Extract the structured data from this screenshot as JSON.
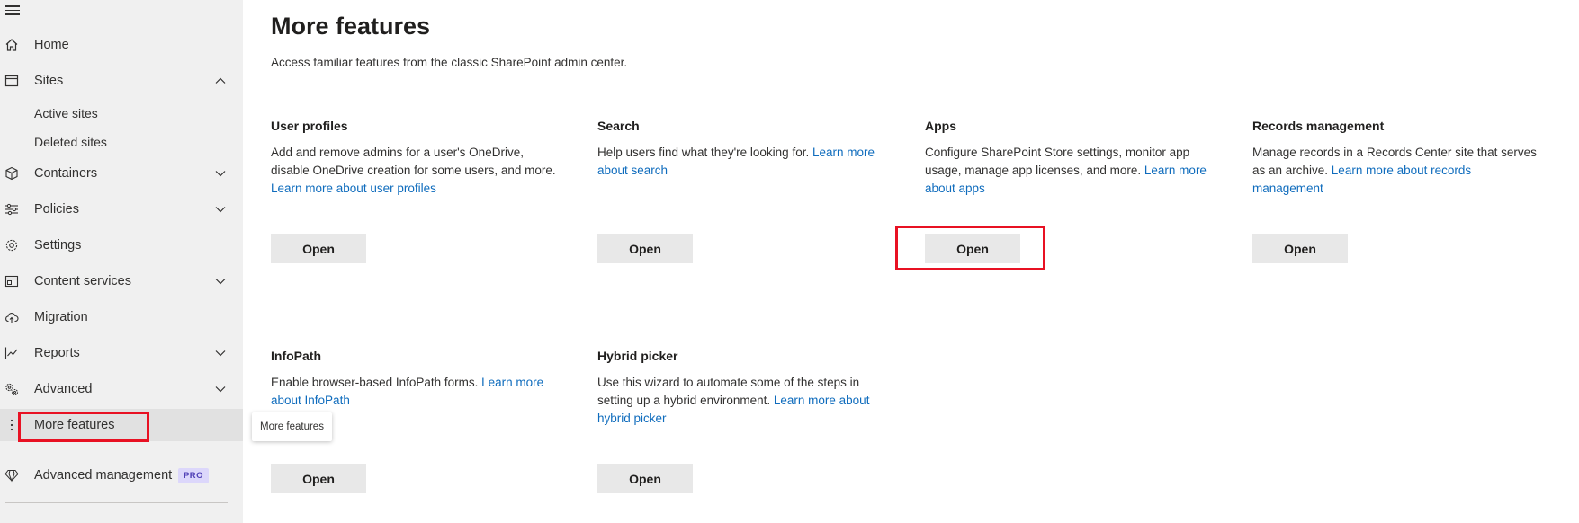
{
  "sidebar": {
    "items": [
      {
        "name": "home",
        "label": "Home",
        "icon": "home-icon",
        "chevron": ""
      },
      {
        "name": "sites",
        "label": "Sites",
        "icon": "sites-icon",
        "chevron": "up"
      },
      {
        "name": "containers",
        "label": "Containers",
        "icon": "cube-icon",
        "chevron": "down"
      },
      {
        "name": "policies",
        "label": "Policies",
        "icon": "sliders-icon",
        "chevron": "down"
      },
      {
        "name": "settings",
        "label": "Settings",
        "icon": "gear-icon",
        "chevron": ""
      },
      {
        "name": "content-services",
        "label": "Content services",
        "icon": "content-services-icon",
        "chevron": "down"
      },
      {
        "name": "migration",
        "label": "Migration",
        "icon": "cloud-upload-icon",
        "chevron": ""
      },
      {
        "name": "reports",
        "label": "Reports",
        "icon": "chart-icon",
        "chevron": "down"
      },
      {
        "name": "advanced",
        "label": "Advanced",
        "icon": "gears-icon",
        "chevron": "down"
      },
      {
        "name": "more-features",
        "label": "More features",
        "icon": "more-vertical-icon",
        "chevron": ""
      },
      {
        "name": "advanced-management",
        "label": "Advanced management",
        "icon": "diamond-icon",
        "chevron": ""
      }
    ],
    "sites_sub": [
      "Active sites",
      "Deleted sites"
    ],
    "pro_badge": "PRO",
    "tooltip": "More features"
  },
  "main": {
    "title": "More features",
    "subtitle": "Access familiar features from the classic SharePoint admin center.",
    "cards": [
      {
        "title": "User profiles",
        "desc": "Add and remove admins for a user's OneDrive, disable OneDrive creation for some users, and more. ",
        "link": "Learn more about user profiles",
        "button": "Open"
      },
      {
        "title": "Search",
        "desc": "Help users find what they're looking for. ",
        "link": "Learn more about search",
        "button": "Open"
      },
      {
        "title": "Apps",
        "desc": "Configure SharePoint Store settings, monitor app usage, manage app licenses, and more. ",
        "link": "Learn more about apps",
        "button": "Open"
      },
      {
        "title": "Records management",
        "desc": "Manage records in a Records Center site that serves as an archive. ",
        "link": "Learn more about records management",
        "button": "Open"
      },
      {
        "title": "InfoPath",
        "desc": "Enable browser-based InfoPath forms. ",
        "link": "Learn more about InfoPath",
        "button": "Open"
      },
      {
        "title": "Hybrid picker",
        "desc": "Use this wizard to automate some of the steps in setting up a hybrid environment. ",
        "link": "Learn more about hybrid picker",
        "button": "Open"
      }
    ]
  },
  "colors": {
    "sidebar_bg": "#f0f0f0",
    "link": "#0f6cbd",
    "highlight": "#e81123",
    "button_bg": "#e8e8e8"
  }
}
